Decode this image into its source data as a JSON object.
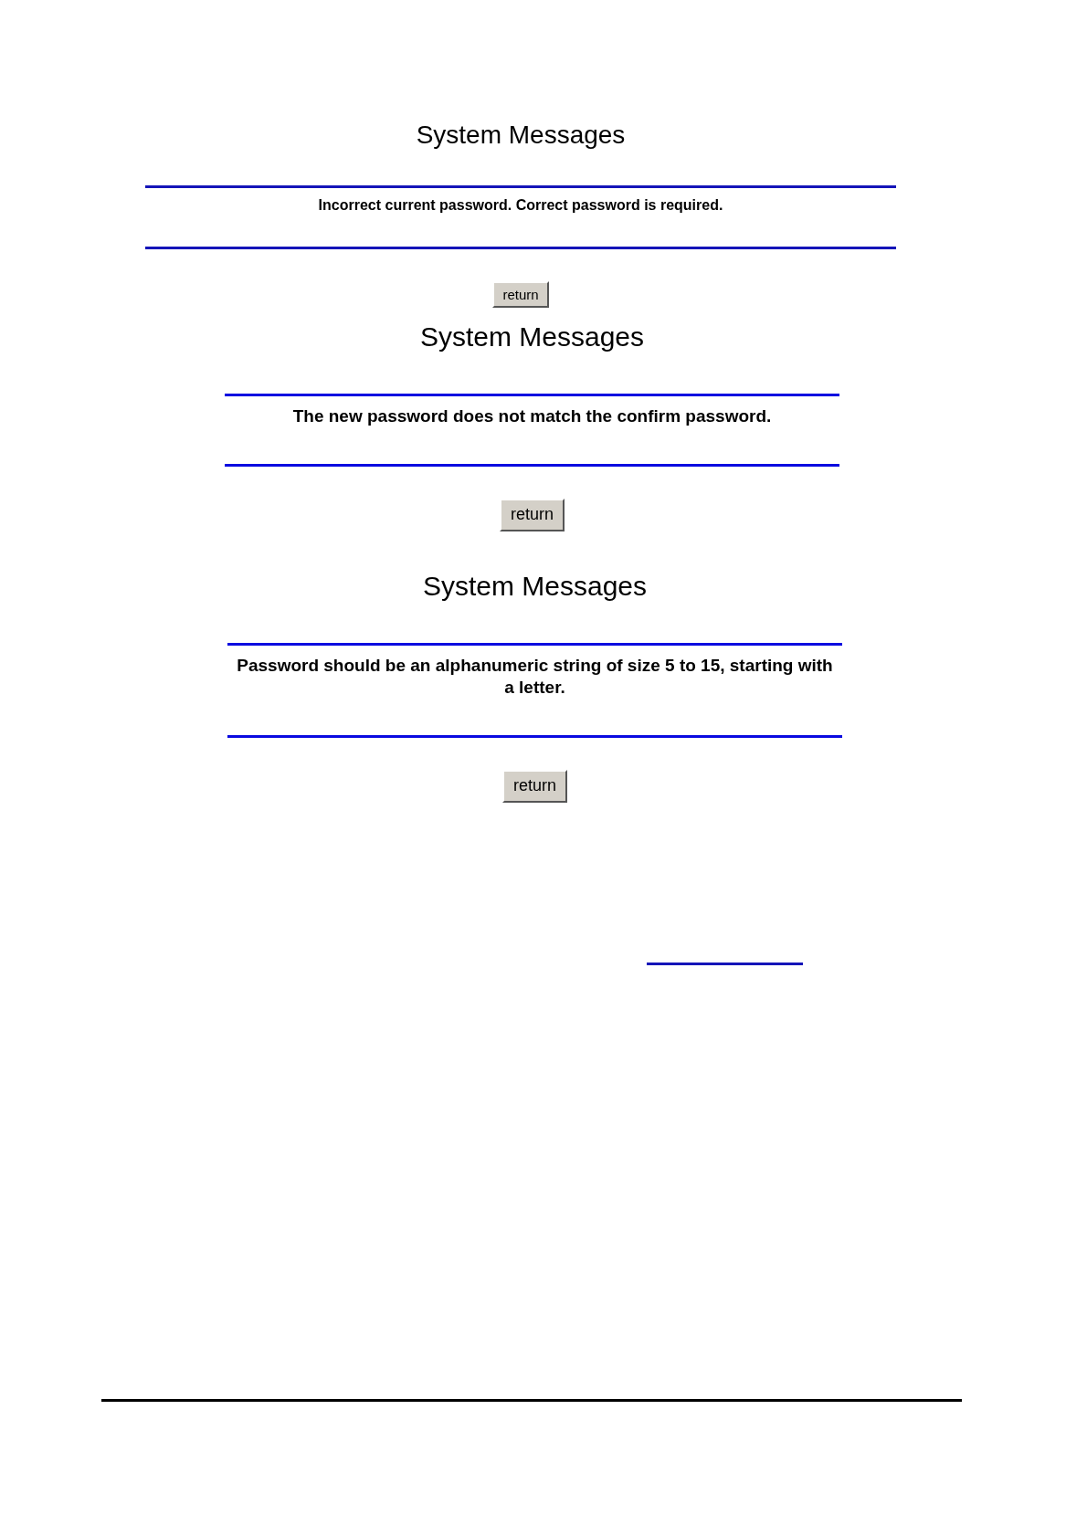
{
  "panels": [
    {
      "title": "System Messages",
      "message": "Incorrect current password. Correct password is required.",
      "button": "return"
    },
    {
      "title": "System Messages",
      "message": "The new password does not match the confirm password.",
      "button": "return"
    },
    {
      "title": "System Messages",
      "message": "Password should be an alphanumeric string of size 5 to 15, starting with a letter.",
      "button": "return"
    }
  ]
}
